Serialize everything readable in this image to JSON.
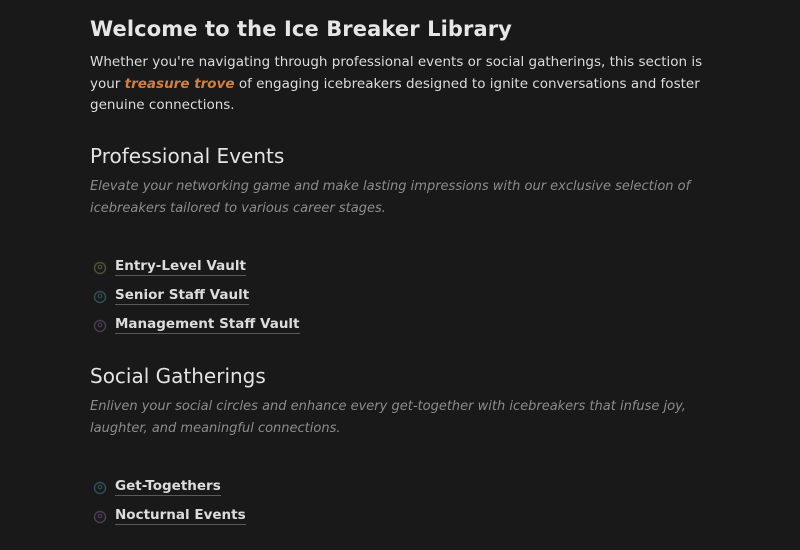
{
  "intro": {
    "title": "Welcome to the Ice Breaker Library",
    "text_before": "Whether you're navigating through professional events or social gatherings, this section is your ",
    "highlight": "treasure trove",
    "text_after": " of engaging icebreakers designed to ignite conversations and foster genuine connections."
  },
  "professional": {
    "title": "Professional Events",
    "description": "Elevate your networking game and make lasting impressions with our exclusive selection of icebreakers tailored to various career stages.",
    "links": [
      {
        "label": "Entry-Level Vault",
        "icon": "badge-icon",
        "icon_color": "#4a5238"
      },
      {
        "label": "Senior Staff Vault",
        "icon": "badge-icon",
        "icon_color": "#2f4f57"
      },
      {
        "label": "Management Staff Vault",
        "icon": "badge-icon",
        "icon_color": "#4b3a57"
      }
    ]
  },
  "social": {
    "title": "Social Gatherings",
    "description": "Enliven your social circles and enhance every get-together with icebreakers that infuse joy, laughter, and meaningful connections.",
    "links": [
      {
        "label": "Get-Togethers",
        "icon": "badge-icon",
        "icon_color": "#2f4f57"
      },
      {
        "label": "Nocturnal Events",
        "icon": "badge-icon",
        "icon_color": "#4b3a57"
      }
    ]
  },
  "colors": {
    "background": "#191919",
    "highlight": "#d27f44",
    "muted_text": "#8c8c8c"
  }
}
